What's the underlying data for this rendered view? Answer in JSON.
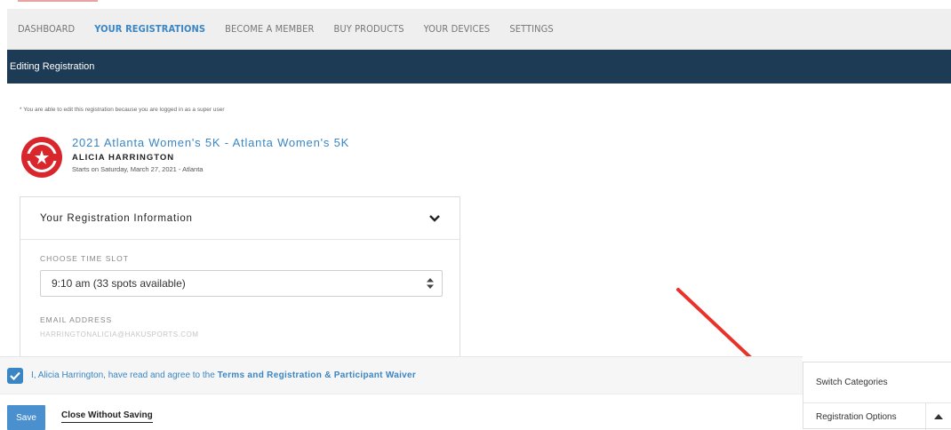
{
  "nav": {
    "items": [
      {
        "label": "DASHBOARD",
        "active": false
      },
      {
        "label": "YOUR REGISTRATIONS",
        "active": true
      },
      {
        "label": "BECOME A MEMBER",
        "active": false
      },
      {
        "label": "BUY PRODUCTS",
        "active": false
      },
      {
        "label": "YOUR DEVICES",
        "active": false
      },
      {
        "label": "SETTINGS",
        "active": false
      }
    ]
  },
  "banner": {
    "title": "Editing Registration"
  },
  "notice": "* You are able to edit this registration because you are logged in as a super user",
  "event": {
    "title": "2021 Atlanta Women's 5K - Atlanta Women's 5K",
    "participant": "ALICIA HARRINGTON",
    "start": "Starts on Saturday, March 27, 2021 - Atlanta"
  },
  "registration_card": {
    "title": "Your Registration Information",
    "time_slot_label": "CHOOSE TIME SLOT",
    "time_slot_value": "9:10 am (33 spots available)",
    "email_label": "EMAIL ADDRESS",
    "email_value": "HARRINGTONALICIA@HAKUSPORTS.COM"
  },
  "agreement": {
    "checked": true,
    "text_prefix": "I, Alicia Harrington, have read and agree to the ",
    "link_text": "Terms and Registration & Participant Waiver"
  },
  "actions": {
    "save_label": "Save",
    "close_label": "Close Without Saving"
  },
  "side_panel": {
    "switch_label": "Switch Categories",
    "options_label": "Registration Options"
  },
  "colors": {
    "accent": "#3a86c4",
    "banner": "#1d3b54",
    "arrow": "#e8322a"
  }
}
